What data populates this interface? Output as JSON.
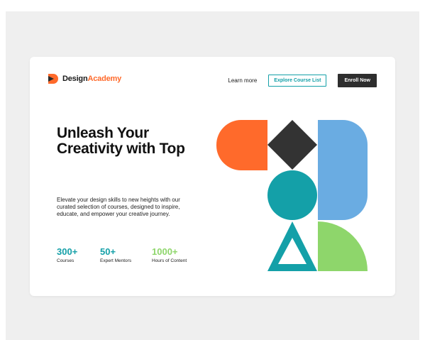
{
  "brand": {
    "name_part1": "Design",
    "name_part2": "Academy",
    "accent_color": "#ff6a2b"
  },
  "nav": {
    "learn_more": "Learn more",
    "explore": "Explore Course List",
    "enroll": "Enroll Now"
  },
  "hero": {
    "headline": "Unleash Your Creativity with Top",
    "description": "Elevate your design skills to new heights with our curated selection of courses, designed to inspire, educate, and empower your creative journey."
  },
  "stats": [
    {
      "value": "300+",
      "label": "Courses",
      "color": "#14a0a8"
    },
    {
      "value": "50+",
      "label": "Expert Mentors",
      "color": "#14a0a8"
    },
    {
      "value": "1000+",
      "label": "Hours of Content",
      "color": "#8ed66b"
    }
  ],
  "colors": {
    "orange": "#ff6a2b",
    "dark": "#333333",
    "blue": "#6aace2",
    "teal": "#14a0a8",
    "green": "#8ed66b"
  }
}
